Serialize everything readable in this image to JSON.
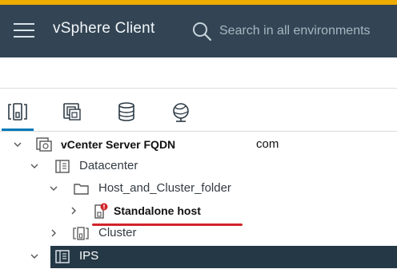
{
  "header": {
    "app_title": "vSphere Client",
    "search_placeholder": "Search in all environments"
  },
  "tabs": [
    {
      "name": "hosts-and-clusters",
      "icon": "hosts-clusters-icon",
      "active": true
    },
    {
      "name": "vms-and-templates",
      "icon": "vms-templates-icon",
      "active": false
    },
    {
      "name": "storage",
      "icon": "database-icon",
      "active": false
    },
    {
      "name": "networking",
      "icon": "network-globe-icon",
      "active": false
    }
  ],
  "tree": {
    "vcenter": {
      "label": "vCenter Server FQDN",
      "suffix": "com",
      "icon": "vcenter-icon",
      "expanded": true
    },
    "datacenter": {
      "label": "Datacenter",
      "icon": "datacenter-icon",
      "expanded": true
    },
    "folder": {
      "label": "Host_and_Cluster_folder",
      "icon": "folder-icon",
      "expanded": true
    },
    "standalone_host": {
      "label": "Standalone host",
      "icon": "host-alert-icon",
      "expanded": false
    },
    "cluster": {
      "label": "Cluster",
      "icon": "cluster-icon",
      "expanded": false
    },
    "ips": {
      "label": "IPS",
      "icon": "datacenter-icon",
      "expanded": true,
      "selected": true
    }
  },
  "colors": {
    "header_bg": "#334554",
    "top_stripe": "#f0ab00",
    "active_tab": "#0079b8",
    "annotation_underline": "#d2232a",
    "selected_row": "#253845",
    "alert_badge": "#d2232a"
  }
}
